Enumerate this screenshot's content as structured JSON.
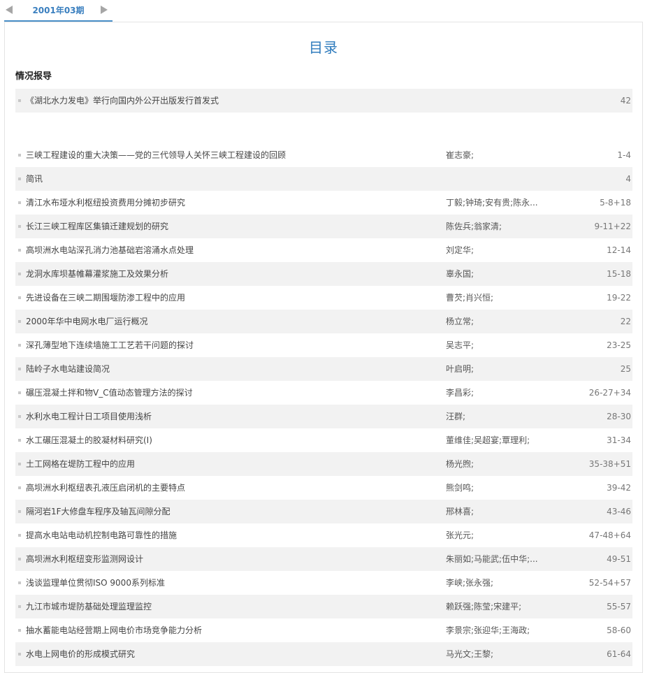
{
  "nav": {
    "issue_label": "2001年03期"
  },
  "toc": {
    "title": "目录"
  },
  "section": {
    "title": "情况报导"
  },
  "featured": {
    "title": "《湖北水力发电》举行向国内外公开出版发行首发式",
    "authors": "",
    "pages": "42"
  },
  "articles": [
    {
      "title": "三峡工程建设的重大决策——党的三代领导人关怀三峡工程建设的回顾",
      "authors": "崔志豪;",
      "pages": "1-4"
    },
    {
      "title": "简讯",
      "authors": "",
      "pages": "4"
    },
    {
      "title": "清江水布垭水利枢纽投资费用分摊初步研究",
      "authors": "丁毅;钟琦;安有贵;陈永...",
      "pages": "5-8+18"
    },
    {
      "title": "长江三峡工程库区集镇迁建规划的研究",
      "authors": "陈佐兵;翁家清;",
      "pages": "9-11+22"
    },
    {
      "title": "高坝洲水电站深孔消力池基础岩溶涌水点处理",
      "authors": "刘定华;",
      "pages": "12-14"
    },
    {
      "title": "龙洞水库坝基帷幕灌浆施工及效果分析",
      "authors": "辜永国;",
      "pages": "15-18"
    },
    {
      "title": "先进设备在三峡二期围堰防渗工程中的应用",
      "authors": "曹芡;肖兴恒;",
      "pages": "19-22"
    },
    {
      "title": "2000年华中电网水电厂运行概况",
      "authors": "杨立常;",
      "pages": "22"
    },
    {
      "title": "深孔薄型地下连续墙施工工艺若干问题的探讨",
      "authors": "吴志平;",
      "pages": "23-25"
    },
    {
      "title": "陆岭子水电站建设简况",
      "authors": "叶启明;",
      "pages": "25"
    },
    {
      "title": "碾压混凝土拌和物V_C值动态管理方法的探讨",
      "authors": "李昌彩;",
      "pages": "26-27+34"
    },
    {
      "title": "水利水电工程计日工项目使用浅析",
      "authors": "汪群;",
      "pages": "28-30"
    },
    {
      "title": "水工碾压混凝土的胶凝材料研究(Ⅰ)",
      "authors": "董维佳;吴超宴;覃理利;",
      "pages": "31-34"
    },
    {
      "title": "土工网格在堤防工程中的应用",
      "authors": "杨光煦;",
      "pages": "35-38+51"
    },
    {
      "title": "高坝洲水利枢纽表孔液压启闭机的主要特点",
      "authors": "熊剑鸣;",
      "pages": "39-42"
    },
    {
      "title": "隔河岩1F大修盘车程序及轴瓦间隙分配",
      "authors": "邢林喜;",
      "pages": "43-46"
    },
    {
      "title": "提高水电站电动机控制电路可靠性的措施",
      "authors": "张光元;",
      "pages": "47-48+64"
    },
    {
      "title": "高坝洲水利枢纽变形监测网设计",
      "authors": "朱丽如;马能武;伍中华;...",
      "pages": "49-51"
    },
    {
      "title": "浅谈监理单位贯彻ISO 9000系列标准",
      "authors": "李峡;张永强;",
      "pages": "52-54+57"
    },
    {
      "title": "九江市城市堤防基础处理监理监控",
      "authors": "赖跃强;陈莹;宋建平;",
      "pages": "55-57"
    },
    {
      "title": "抽水蓄能电站经营期上网电价市场竞争能力分析",
      "authors": "李景宗;张迎华;王海政;",
      "pages": "58-60"
    },
    {
      "title": "水电上网电价的形成模式研究",
      "authors": "马光文;王黎;",
      "pages": "61-64"
    }
  ]
}
